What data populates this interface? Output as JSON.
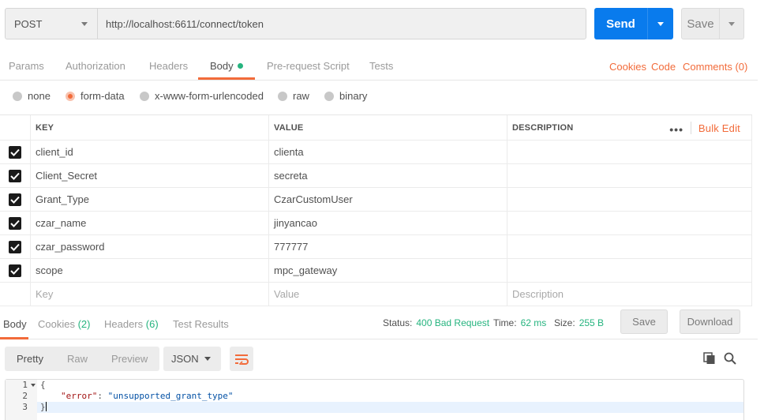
{
  "request": {
    "method": "POST",
    "url": "http://localhost:6611/connect/token",
    "send_label": "Send",
    "save_label": "Save"
  },
  "request_tabs": [
    {
      "label": "Params"
    },
    {
      "label": "Authorization"
    },
    {
      "label": "Headers"
    },
    {
      "label": "Body",
      "active": true
    },
    {
      "label": "Pre-request Script"
    },
    {
      "label": "Tests"
    }
  ],
  "request_links": {
    "cookies": "Cookies",
    "code": "Code",
    "comments": "Comments (0)"
  },
  "body_types": [
    {
      "label": "none"
    },
    {
      "label": "form-data",
      "selected": true
    },
    {
      "label": "x-www-form-urlencoded"
    },
    {
      "label": "raw"
    },
    {
      "label": "binary"
    }
  ],
  "params_table": {
    "headers": {
      "key": "KEY",
      "value": "VALUE",
      "description": "DESCRIPTION"
    },
    "more_label": "•••",
    "bulk_edit": "Bulk Edit",
    "rows": [
      {
        "checked": true,
        "key": "client_id",
        "value": "clienta",
        "description": ""
      },
      {
        "checked": true,
        "key": "Client_Secret",
        "value": "secreta",
        "description": ""
      },
      {
        "checked": true,
        "key": "Grant_Type",
        "value": "CzarCustomUser",
        "description": ""
      },
      {
        "checked": true,
        "key": "czar_name",
        "value": "jinyancao",
        "description": ""
      },
      {
        "checked": true,
        "key": "czar_password",
        "value": "777777",
        "description": ""
      },
      {
        "checked": true,
        "key": "scope",
        "value": "mpc_gateway",
        "description": ""
      }
    ],
    "placeholders": {
      "key": "Key",
      "value": "Value",
      "description": "Description"
    }
  },
  "response": {
    "tabs": [
      {
        "label": "Body",
        "active": true
      },
      {
        "label": "Cookies",
        "count": "(2)"
      },
      {
        "label": "Headers",
        "count": "(6)"
      },
      {
        "label": "Test Results"
      }
    ],
    "status_label": "Status:",
    "status_value": "400 Bad Request",
    "time_label": "Time:",
    "time_value": "62 ms",
    "size_label": "Size:",
    "size_value": "255 B",
    "save_label": "Save",
    "download_label": "Download",
    "views": [
      {
        "label": "Pretty",
        "active": true
      },
      {
        "label": "Raw"
      },
      {
        "label": "Preview"
      }
    ],
    "format": "JSON",
    "code_lines": [
      {
        "num": "1",
        "text": "{"
      },
      {
        "num": "2",
        "key": "\"error\"",
        "sep": ": ",
        "value": "\"unsupported_grant_type\""
      },
      {
        "num": "3",
        "text": "}"
      }
    ]
  },
  "colors": {
    "accent": "#f26b3a",
    "send": "#097bed",
    "success": "#26b47f"
  },
  "icons": [
    "chevron-down-icon",
    "checkbox-checked-icon",
    "wrap-lines-icon",
    "copy-icon",
    "search-icon",
    "fold-arrow-icon"
  ]
}
